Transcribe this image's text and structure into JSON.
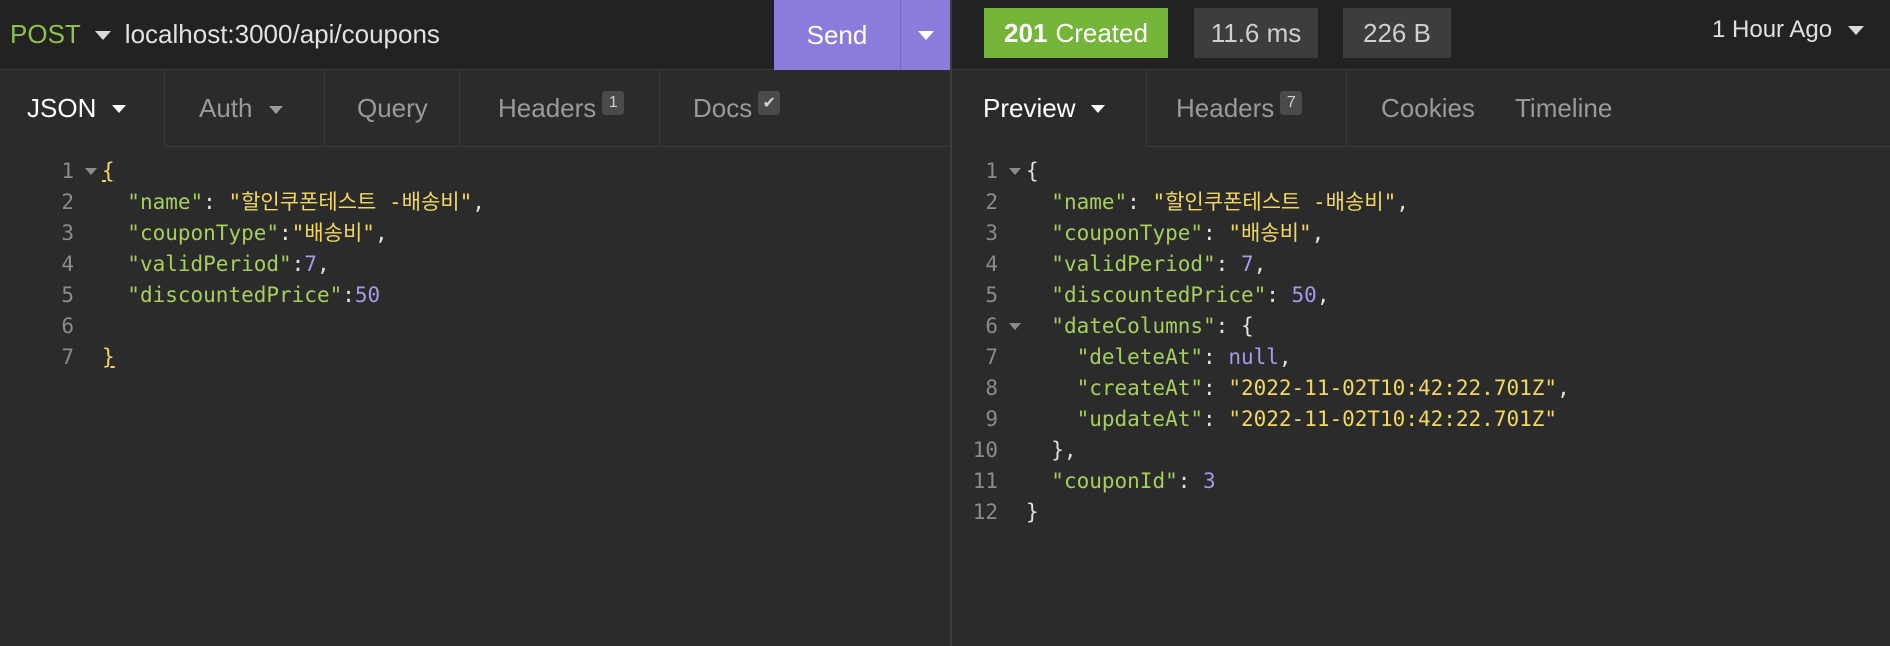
{
  "request": {
    "method": "POST",
    "url": "localhost:3000/api/coupons",
    "send_label": "Send",
    "tabs": [
      {
        "label": "JSON",
        "badge": ""
      },
      {
        "label": "Auth",
        "badge": ""
      },
      {
        "label": "Query",
        "badge": ""
      },
      {
        "label": "Headers",
        "badge": "1"
      },
      {
        "label": "Docs",
        "badge": "✔"
      }
    ],
    "body": {
      "name": "할인쿠폰테스트 -배송비",
      "couponType": "배송비",
      "validPeriod": "7",
      "discountedPrice": "50"
    }
  },
  "response": {
    "status_code": "201",
    "status_text": "Created",
    "time": "11.6 ms",
    "size": "226 B",
    "age": "1 Hour Ago",
    "tabs": [
      {
        "label": "Preview",
        "badge": ""
      },
      {
        "label": "Headers",
        "badge": "7"
      },
      {
        "label": "Cookies",
        "badge": ""
      },
      {
        "label": "Timeline",
        "badge": ""
      }
    ],
    "body": {
      "name": "할인쿠폰테스트 -배송비",
      "couponType": "배송비",
      "validPeriod": "7",
      "discountedPrice": "50",
      "deleteAt": "null",
      "createAt": "2022-11-02T10:42:22.701Z",
      "updateAt": "2022-11-02T10:42:22.701Z",
      "couponId": "3"
    }
  },
  "colors": {
    "send": "#8a7cdb",
    "status_ok": "#75b53a",
    "method": "#8fc24a",
    "key": "#a6cf5c",
    "string": "#f2d861",
    "number": "#a898e8"
  },
  "icons": {
    "fold": "fold-caret-icon",
    "dropdown": "chevron-down-icon"
  }
}
